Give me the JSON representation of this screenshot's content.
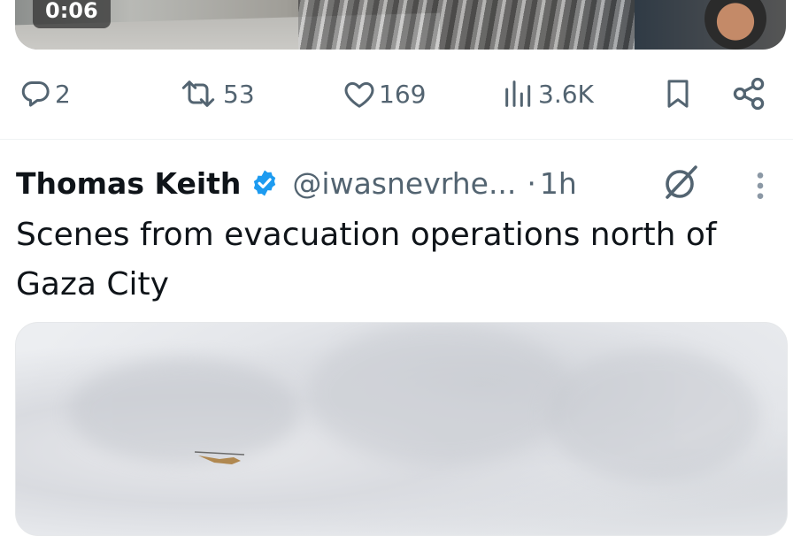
{
  "prev_tweet": {
    "video_duration": "0:06",
    "actions": {
      "replies": "2",
      "reposts": "53",
      "likes": "169",
      "views": "3.6K"
    }
  },
  "tweet": {
    "author_name": "Thomas Keith",
    "handle": "@iwasnevrhe...",
    "separator": "·",
    "time": "1h",
    "text": "Scenes from evacuation operations north of Gaza City"
  },
  "colors": {
    "text_primary": "#0f1419",
    "text_secondary": "#536471",
    "verified_blue": "#1d9bf0",
    "divider": "#eff3f4"
  },
  "icons": [
    "reply-icon",
    "repost-icon",
    "like-icon",
    "views-icon",
    "bookmark-icon",
    "share-icon",
    "verified-badge-icon",
    "grok-icon",
    "more-icon"
  ]
}
